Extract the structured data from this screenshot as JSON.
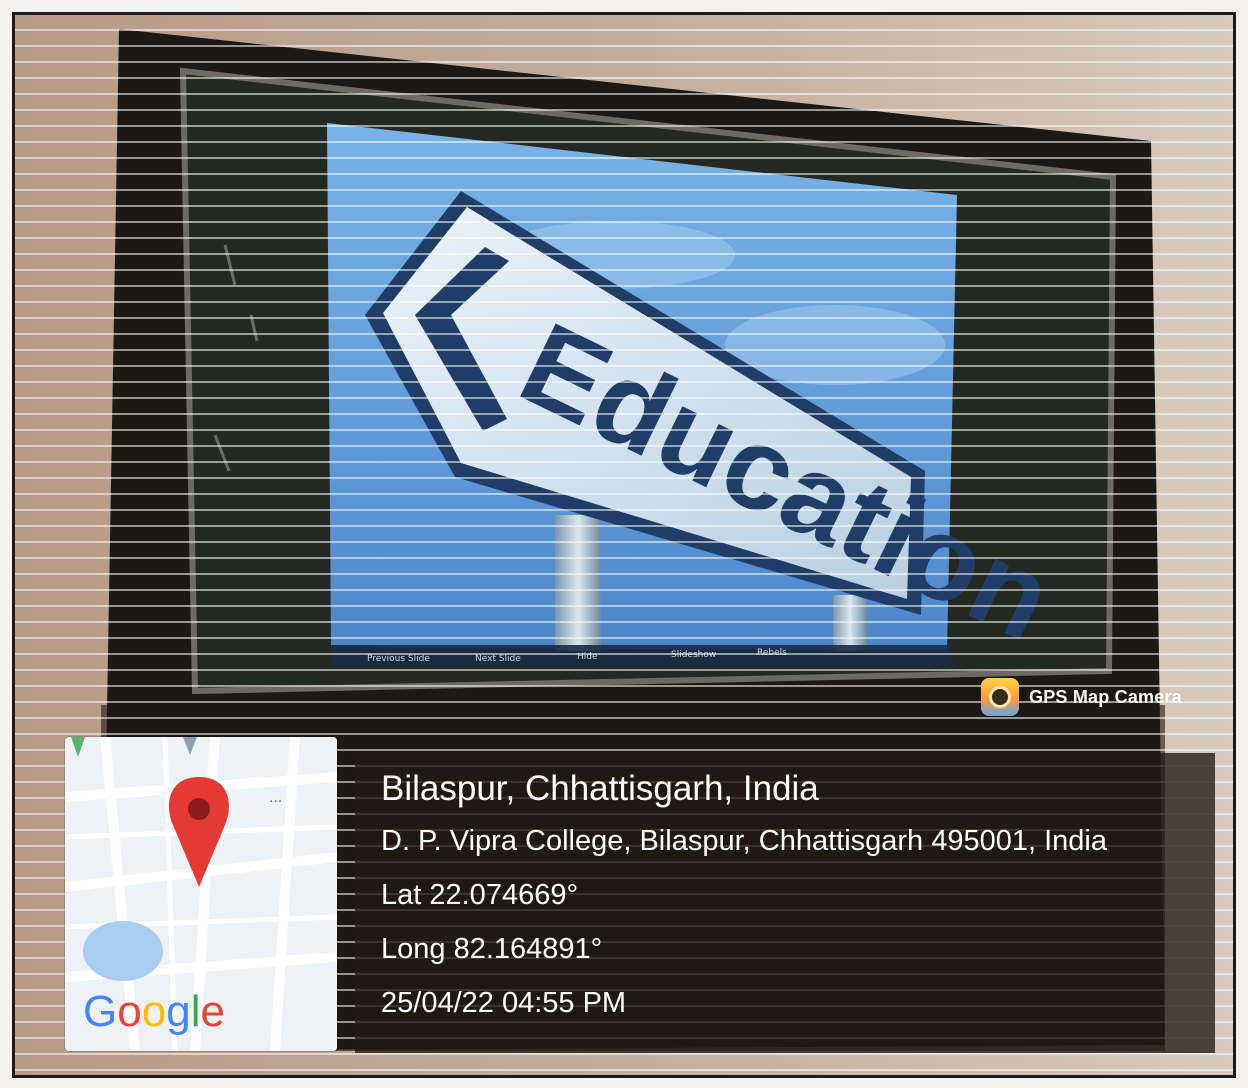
{
  "sign_text": "Education",
  "slideshow_controls": [
    "Previous Slide",
    "Next Slide",
    "Hide",
    "Slideshow",
    "Rebels"
  ],
  "app_badge": {
    "label": "GPS Map Camera",
    "icon": "gps-map-camera-icon"
  },
  "location": {
    "title": "Bilaspur, Chhattisgarh, India",
    "address": "D. P. Vipra College, Bilaspur, Chhattisgarh 495001, India",
    "lat": "Lat 22.074669°",
    "long": "Long 82.164891°",
    "timestamp": "25/04/22 04:55 PM"
  },
  "map": {
    "brand": "Google",
    "menu": "...",
    "pin_icon": "map-pin-icon",
    "pin_color": "#e53935"
  },
  "colors": {
    "panel_bg": "#221814",
    "text": "#ffffff",
    "sky": "#5f9ad8"
  }
}
